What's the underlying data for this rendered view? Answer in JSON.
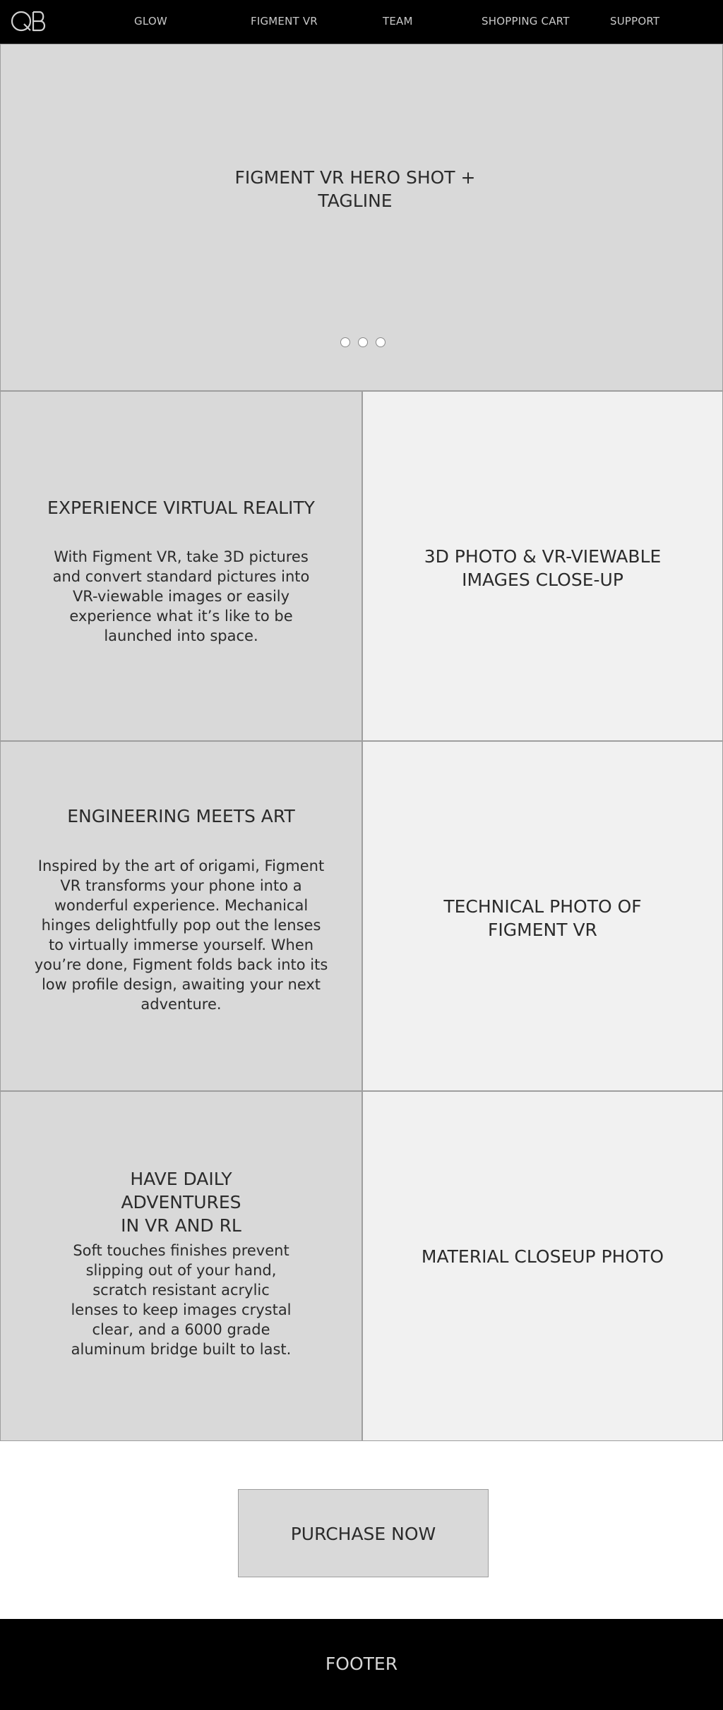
{
  "header": {
    "logo_icon": "qb-logo-icon",
    "nav": [
      "GLOW",
      "FIGMENT VR",
      "TEAM",
      "SHOPPING CART",
      "SUPPORT"
    ]
  },
  "hero": {
    "title_line1": "FIGMENT VR HERO SHOT +",
    "title_line2": "TAGLINE",
    "carousel_dot_count": 3
  },
  "features": [
    {
      "heading": "EXPERIENCE VIRTUAL REALITY",
      "body": "With Figment VR, take 3D pictures and convert standard pictures into VR-viewable images or easily experience what it’s like to be launched into space.",
      "photo_line1": "3D PHOTO & VR-VIEWABLE",
      "photo_line2": "IMAGES CLOSE-UP"
    },
    {
      "heading": "ENGINEERING MEETS ART",
      "body": "Inspired by the art of origami, Figment VR transforms your phone into a wonderful experience. Mechanical hinges delightfully pop out the lenses to virtually immerse yourself. When you’re done, Figment folds back into its low profile design, awaiting your next adventure.",
      "photo_line1": "TECHNICAL PHOTO OF",
      "photo_line2": "FIGMENT VR"
    },
    {
      "heading_line1": "HAVE DAILY ADVENTURES",
      "heading_line2": "IN VR AND RL",
      "body": "Soft touches finishes prevent slipping out of your hand, scratch resistant acrylic lenses to keep images crystal clear, and a 6000 grade aluminum bridge built to last.",
      "photo_line1": "MATERIAL CLOSEUP PHOTO"
    }
  ],
  "purchase": {
    "label": "PURCHASE NOW"
  },
  "footer": {
    "label": "FOOTER"
  },
  "colors": {
    "bar_background": "#000000",
    "placeholder_dark": "#d9d9d9",
    "placeholder_light": "#f1f1f1",
    "border": "#9e9e9e",
    "nav_text": "#c9c9c9"
  }
}
